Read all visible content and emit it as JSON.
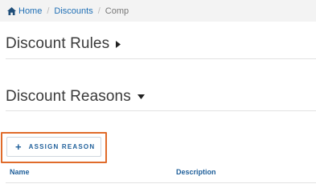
{
  "breadcrumb": {
    "home": "Home",
    "separator": "/",
    "discounts": "Discounts",
    "current": "Comp"
  },
  "sections": {
    "rules": {
      "title": "Discount Rules",
      "state": "collapsed"
    },
    "reasons": {
      "title": "Discount Reasons",
      "state": "expanded"
    }
  },
  "actions": {
    "assign_plus": "+",
    "assign_label": "ASSIGN REASON"
  },
  "table": {
    "columns": [
      "Name",
      "Description"
    ]
  },
  "colors": {
    "link": "#1f6fb5",
    "accent": "#1f5f9a",
    "highlight": "#e06b2a",
    "breadcrumb_bg": "#f3f3f3"
  },
  "icons": {
    "home": "home-icon",
    "rules_caret": "caret-right-icon",
    "reasons_caret": "caret-down-icon"
  }
}
